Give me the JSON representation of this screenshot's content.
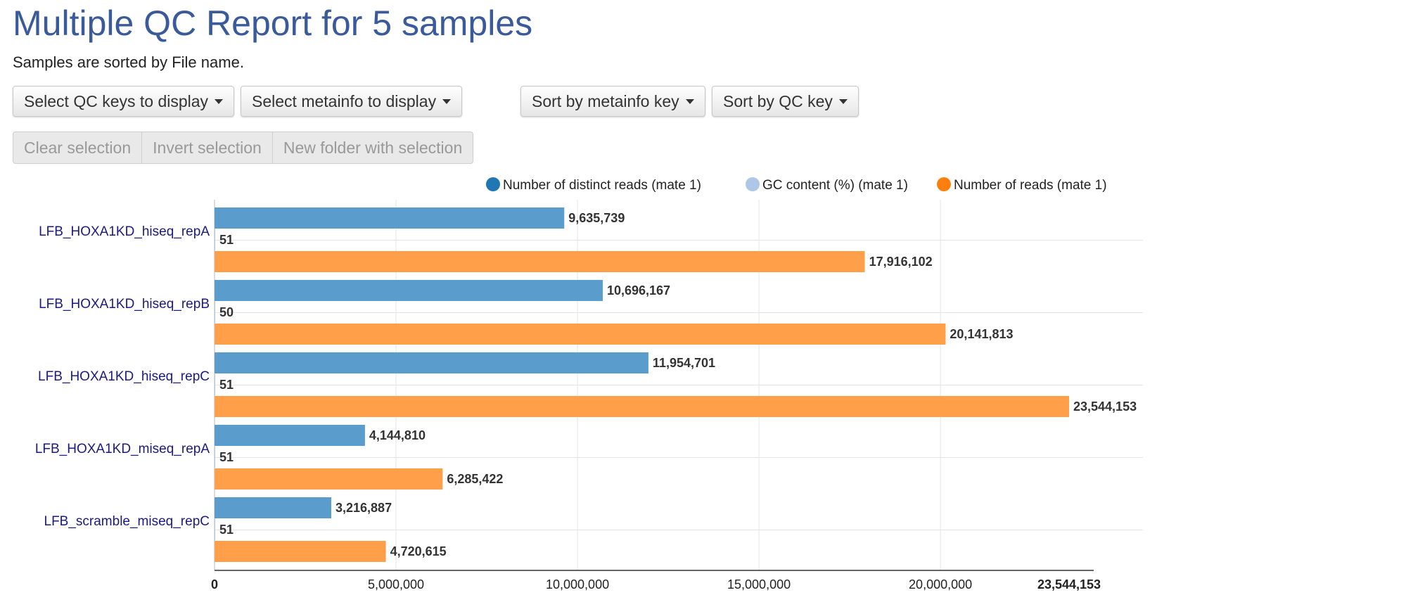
{
  "header": {
    "title": "Multiple QC Report for 5 samples",
    "subtitle": "Samples are sorted by File name."
  },
  "toolbar": {
    "select_qc_keys": "Select QC keys to display",
    "select_metainfo": "Select metainfo to display",
    "sort_metainfo": "Sort by metainfo key",
    "sort_qc": "Sort by QC key"
  },
  "selection": {
    "clear": "Clear selection",
    "invert": "Invert selection",
    "new_folder": "New folder with selection"
  },
  "chart_data": {
    "type": "bar",
    "orientation": "horizontal",
    "categories": [
      "LFB_HOXA1KD_hiseq_repA",
      "LFB_HOXA1KD_hiseq_repB",
      "LFB_HOXA1KD_hiseq_repC",
      "LFB_HOXA1KD_miseq_repA",
      "LFB_scramble_miseq_repC"
    ],
    "series": [
      {
        "name": "Number of distinct reads (mate 1)",
        "color": "#1f77b4",
        "bar_color": "#5a9ccc",
        "values": [
          9635739,
          10696167,
          11954701,
          4144810,
          3216887
        ],
        "labels": [
          "9,635,739",
          "10,696,167",
          "11,954,701",
          "4,144,810",
          "3,216,887"
        ]
      },
      {
        "name": "GC content (%) (mate 1)",
        "color": "#aec7e8",
        "bar_color": "#aec7e8",
        "values": [
          51,
          50,
          51,
          51,
          51
        ],
        "labels": [
          "51",
          "50",
          "51",
          "51",
          "51"
        ]
      },
      {
        "name": "Number of reads (mate 1)",
        "color": "#ff7f0e",
        "bar_color": "#ff9f4a",
        "values": [
          17916102,
          20141813,
          23544153,
          6285422,
          4720615
        ],
        "labels": [
          "17,916,102",
          "20,141,813",
          "23,544,153",
          "6,285,422",
          "4,720,615"
        ]
      }
    ],
    "xlim": [
      0,
      23544153
    ],
    "xticks": [
      0,
      5000000,
      10000000,
      15000000,
      20000000,
      23544153
    ],
    "xtick_labels": [
      "0",
      "5,000,000",
      "10,000,000",
      "15,000,000",
      "20,000,000",
      "23,544,153"
    ],
    "xtick_bold": [
      true,
      false,
      false,
      false,
      false,
      true
    ],
    "legend_position": "top-right",
    "grid": true
  }
}
